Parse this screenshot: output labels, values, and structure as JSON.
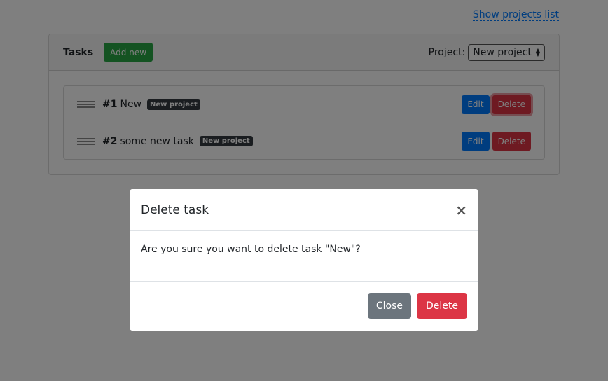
{
  "top_link": {
    "label": "Show projects list"
  },
  "card": {
    "title": "Tasks",
    "add_label": "Add new",
    "project_label": "Project:",
    "project_value": "New project"
  },
  "tasks": [
    {
      "number": "#1",
      "name": "New",
      "badge": "New project",
      "edit_label": "Edit",
      "delete_label": "Delete"
    },
    {
      "number": "#2",
      "name": "some new task",
      "badge": "New project",
      "edit_label": "Edit",
      "delete_label": "Delete"
    }
  ],
  "modal": {
    "title": "Delete task",
    "close_glyph": "×",
    "body": "Are you sure you want to delete task \"New\"?",
    "close_label": "Close",
    "delete_label": "Delete"
  },
  "colors": {
    "primary": "#007bff",
    "success": "#28a745",
    "danger": "#dc3545",
    "secondary": "#6c757d",
    "dark": "#343a40"
  },
  "icons": [
    "drag-handle-icon",
    "select-arrows-icon",
    "close-icon"
  ]
}
